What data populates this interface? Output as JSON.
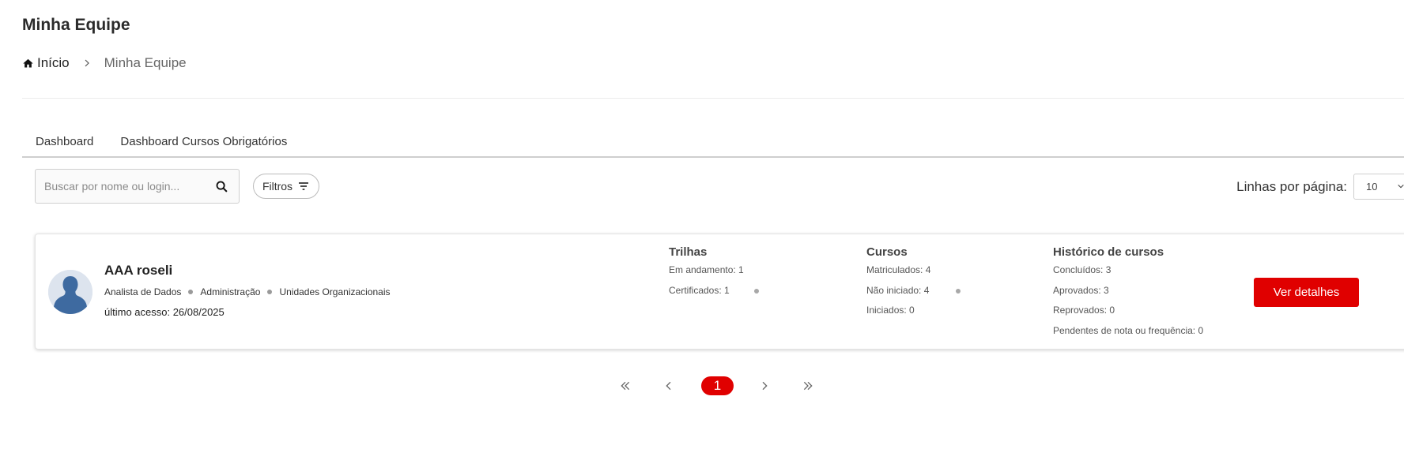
{
  "page": {
    "title": "Minha Equipe"
  },
  "breadcrumb": {
    "home": "Início",
    "current": "Minha Equipe"
  },
  "tabs": [
    {
      "label": "Dashboard"
    },
    {
      "label": "Dashboard Cursos Obrigatórios"
    }
  ],
  "search": {
    "placeholder": "Buscar por nome ou login...",
    "value": ""
  },
  "filters": {
    "label": "Filtros"
  },
  "rows_per_page": {
    "label": "Linhas por página:",
    "value": "10"
  },
  "users": [
    {
      "name": "AAA roseli",
      "role": "Analista de Dados",
      "department": "Administração",
      "org_unit": "Unidades Organizacionais",
      "last_access": "último acesso: 26/08/2025",
      "trilhas": {
        "title": "Trilhas",
        "lines": [
          "Em andamento: 1",
          "Certificados: 1"
        ]
      },
      "cursos": {
        "title": "Cursos",
        "lines": [
          "Matriculados: 4",
          "Não iniciado: 4",
          "Iniciados: 0"
        ]
      },
      "historico": {
        "title": "Histórico de cursos",
        "lines": [
          "Concluídos: 3",
          "Aprovados: 3",
          "Reprovados: 0",
          "Pendentes de nota ou frequência: 0"
        ]
      },
      "details_label": "Ver detalhes"
    }
  ],
  "pagination": {
    "current": "1"
  },
  "colors": {
    "accent": "#e00000",
    "avatar_bg": "#dde4ee",
    "avatar_fg": "#3e6aa0"
  }
}
